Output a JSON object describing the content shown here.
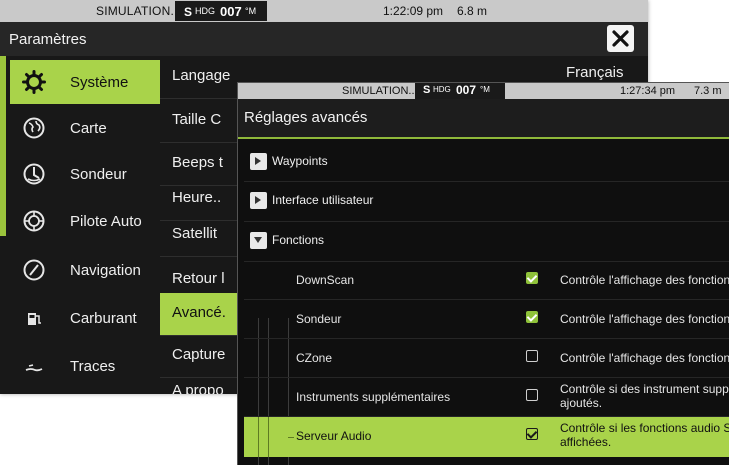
{
  "back_window": {
    "status": {
      "sim": "SIMULATION...",
      "hdg_s": "S",
      "hdg_label": "HDG",
      "hdg_value": "007",
      "hdg_unit": "°M",
      "time": "1:22:09 pm",
      "depth": "6.8 m"
    },
    "title": "Paramètres",
    "sidebar": [
      {
        "label": "Système",
        "icon": "gear-icon",
        "active": true
      },
      {
        "label": "Carte",
        "icon": "globe-icon",
        "active": false
      },
      {
        "label": "Sondeur",
        "icon": "sonar-icon",
        "active": false
      },
      {
        "label": "Pilote Auto",
        "icon": "autopilot-wheel-icon",
        "active": false
      },
      {
        "label": "Navigation",
        "icon": "compass-icon",
        "active": false
      },
      {
        "label": "Carburant",
        "icon": "fuel-pump-icon",
        "active": false
      },
      {
        "label": "Traces",
        "icon": "track-icon",
        "active": false
      }
    ],
    "settings": [
      {
        "label": "Langage",
        "active": false
      },
      {
        "label": "Taille C",
        "active": false
      },
      {
        "label": "Beeps t",
        "active": false
      },
      {
        "label": "Heure..",
        "active": false
      },
      {
        "label": "Satellit",
        "active": false
      },
      {
        "label": "Retour l",
        "active": false
      },
      {
        "label": "Avancé.",
        "active": true
      },
      {
        "label": "Capture",
        "active": false
      },
      {
        "label": "A propo",
        "active": false
      }
    ],
    "language_value": "Français"
  },
  "front_window": {
    "status": {
      "sim": "SIMULATION...",
      "hdg_s": "S",
      "hdg_label": "HDG",
      "hdg_value": "007",
      "hdg_unit": "°M",
      "time": "1:27:34 pm",
      "depth": "7.3 m"
    },
    "title": "Réglages avancés",
    "nodes": [
      {
        "label": "Waypoints",
        "expanded": false
      },
      {
        "label": "Interface utilisateur",
        "expanded": false
      },
      {
        "label": "Fonctions",
        "expanded": true
      }
    ],
    "functions": [
      {
        "name": "DownScan",
        "checked": true,
        "description": "Contrôle l'affichage des fonctions"
      },
      {
        "name": "Sondeur",
        "checked": true,
        "description": "Contrôle l'affichage des fonctions"
      },
      {
        "name": "CZone",
        "checked": false,
        "description": "Contrôle l'affichage des fonctions"
      },
      {
        "name": "Instruments supplémentaires",
        "checked": false,
        "description_line1": "Contrôle si des instrument supplé",
        "description_line2": "ajoutés."
      },
      {
        "name": "Serveur Audio",
        "checked": true,
        "selected": true,
        "description_line1": "Contrôle si les fonctions audio Sor",
        "description_line2": "affichées."
      }
    ]
  },
  "colors": {
    "accent": "#a9d34a",
    "check_on": "#8fc23a",
    "panel_dark": "#181818",
    "status_bar": "#c9c9c9"
  }
}
